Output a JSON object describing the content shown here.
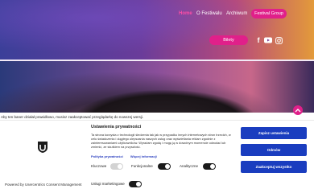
{
  "nav": {
    "home": "Home",
    "ofestivalu": "O Festiwalu",
    "archiwum": "Archiwum",
    "festival_group": "Festival Group",
    "active_color": "#ff4da6"
  },
  "header": {
    "tickets": "Bilety",
    "social_icons": [
      "facebook-icon",
      "youtube-icon",
      "instagram-icon"
    ]
  },
  "notice": "Aby ten baner działał prawidłowo, musisz zaakceptować przeglądarkę do nowszej wersji.",
  "consent": {
    "title": "Ustawienia prywatności",
    "body": "Ta strona korzysta z technologii śledzenia tak jak w przypadku innych internetowych stron trzecich, w celu świadczenia i ciągłego ulepszania naszych usług oraz wyświetlania reklam zgodnie z zainteresowaniami użytkowników. Wyrażam zgodę i mogę ją w dowolnym momencie odwołać lub zmienić, ze skutkiem na przyszłość.",
    "links": [
      "Polityka prywatności",
      "Więcej informacji"
    ],
    "toggles": [
      {
        "label": "Kluczowe",
        "state": "locked-on"
      },
      {
        "label": "Funkcjonalne",
        "state": "on"
      },
      {
        "label": "Analityczne",
        "state": "on"
      },
      {
        "label": "Usługi marketingowe",
        "state": "on"
      }
    ],
    "buttons": {
      "accept_all": "Zapisz ustawienia",
      "deny": "Odmów",
      "accept": "Zaakceptuj wszystko"
    },
    "powered_by": "Powered by Usercentrics Consent Management",
    "accent_color": "#1a3dbf"
  }
}
